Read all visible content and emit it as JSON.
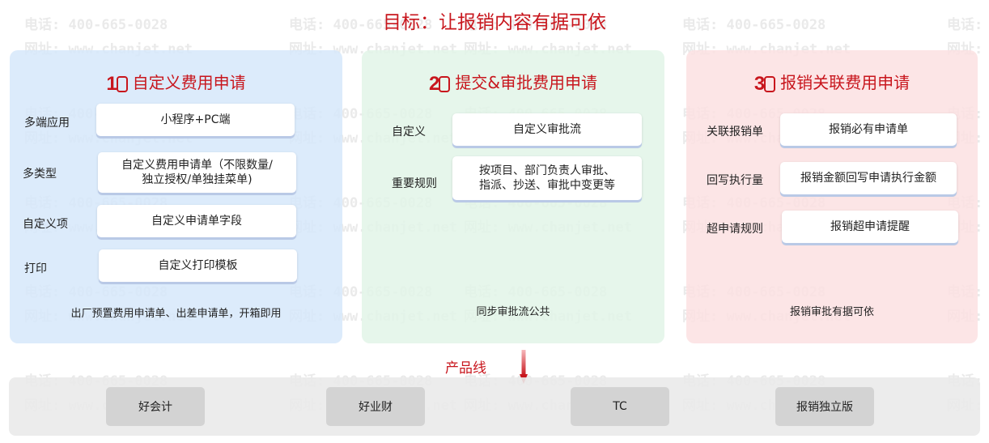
{
  "watermark": {
    "phone": "电话: 400-665-0028",
    "site": "网址: www.chanjet.net"
  },
  "goal_title": "目标：让报销内容有据可依",
  "panels": [
    {
      "number": "1",
      "title": "自定义费用申请",
      "rows": [
        {
          "label": "多端应用",
          "box": "小程序+PC端"
        },
        {
          "label": "多类型",
          "box_line1": "自定义费用申请单（不限数量/",
          "box_line2": "独立授权/单独挂菜单)"
        },
        {
          "label": "自定义项",
          "box": "自定义申请单字段"
        },
        {
          "label": "打印",
          "box": "自定义打印模板"
        }
      ],
      "note": "出厂预置费用申请单、出差申请单，开箱即用"
    },
    {
      "number": "2",
      "title": "提交&审批费用申请",
      "rows": [
        {
          "label": "自定义",
          "box": "自定义审批流"
        },
        {
          "label": "重要规则",
          "box_line1": "按项目、部门负责人审批、",
          "box_line2": "指派、抄送、审批中变更等"
        }
      ],
      "note": "同步审批流公共"
    },
    {
      "number": "3",
      "title": "报销关联费用申请",
      "rows": [
        {
          "label": "关联报销单",
          "box": "报销必有申请单"
        },
        {
          "label": "回写执行量",
          "box": "报销金额回写申请执行金额"
        },
        {
          "label": "超申请规则",
          "box": "报销超申请提醒"
        }
      ],
      "note": "报销审批有据可依"
    }
  ],
  "product_line": {
    "label": "产品线",
    "products": [
      "好会计",
      "好业财",
      "TC",
      "报销独立版"
    ]
  },
  "colors": {
    "accent": "#c8161d",
    "panel1": "#d6e8fa",
    "panel2": "#e2f4e8",
    "panel3": "#fce0e2",
    "product_box": "#d3d3d3"
  }
}
